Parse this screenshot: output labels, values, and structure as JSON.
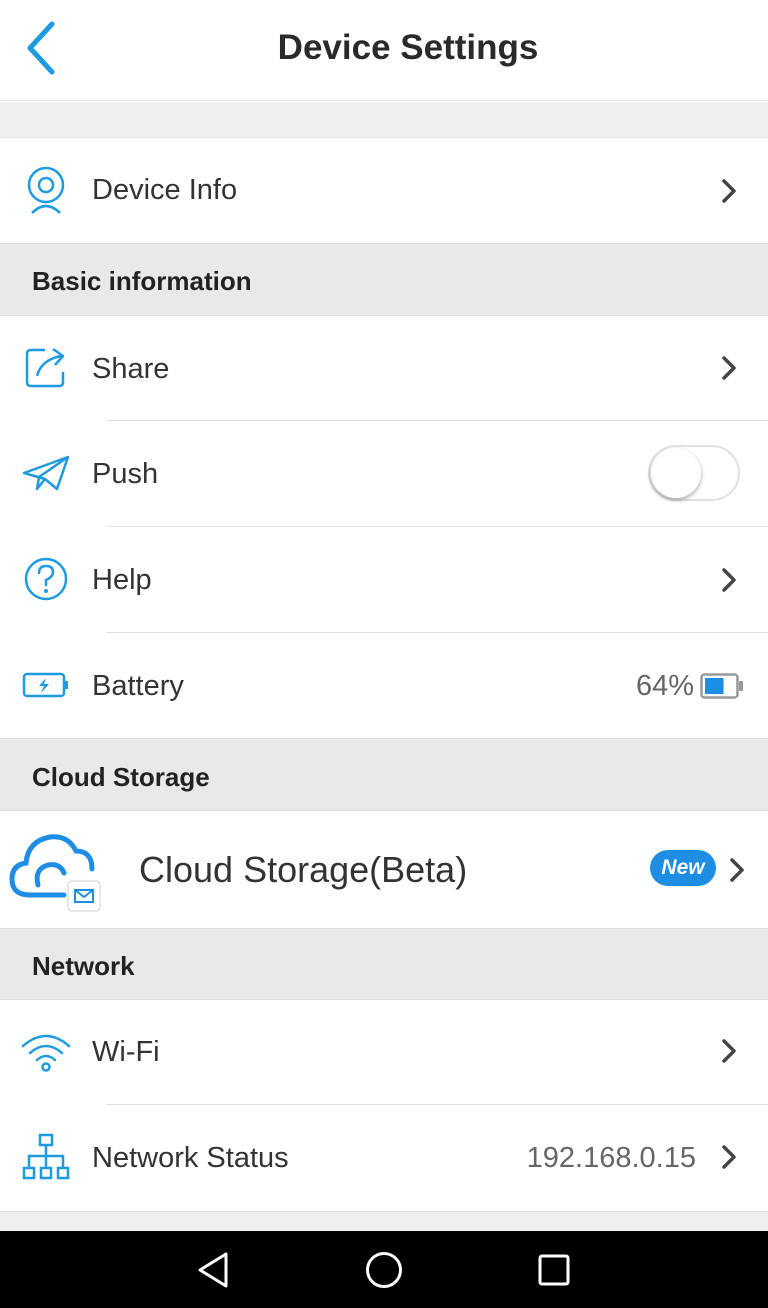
{
  "header": {
    "title": "Device Settings",
    "back_icon": "back-arrow-icon"
  },
  "device_info": {
    "label": "Device Info",
    "icon": "camera-icon"
  },
  "sections": {
    "basic": "Basic information",
    "cloud": "Cloud Storage",
    "network": "Network"
  },
  "basic_items": {
    "share": {
      "label": "Share",
      "icon": "share-icon"
    },
    "push": {
      "label": "Push",
      "icon": "paper-plane-icon",
      "enabled": false
    },
    "help": {
      "label": "Help",
      "icon": "help-icon"
    },
    "battery": {
      "label": "Battery",
      "icon": "battery-charging-icon",
      "value": "64%",
      "level": 0.64
    }
  },
  "cloud_item": {
    "label": "Cloud Storage(Beta)",
    "badge": "New",
    "icon": "cloud-icon"
  },
  "network_items": {
    "wifi": {
      "label": "Wi-Fi",
      "icon": "wifi-icon"
    },
    "status": {
      "label": "Network Status",
      "value": "192.168.0.15",
      "icon": "network-tree-icon"
    }
  },
  "colors": {
    "accent": "#1e9be0",
    "badge": "#1e8ee4",
    "section_bg": "#e9e9e9",
    "text": "#333333"
  },
  "system_nav": {
    "back": "nav-back-icon",
    "home": "nav-home-icon",
    "recents": "nav-recents-icon"
  }
}
